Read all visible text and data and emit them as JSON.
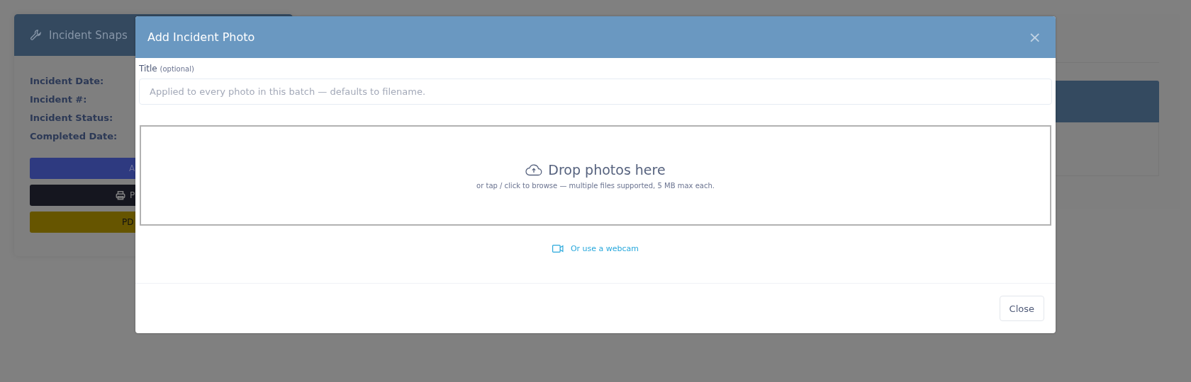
{
  "background_card": {
    "title": "Incident Snaps",
    "fields": [
      {
        "label": "Incident Date:"
      },
      {
        "label": "Incident #:"
      },
      {
        "label": "Incident Status:"
      },
      {
        "label": "Completed Date:"
      }
    ],
    "buttons": [
      {
        "kind": "primary",
        "label": "A"
      },
      {
        "kind": "dark",
        "label": "P"
      },
      {
        "kind": "warning",
        "label": "PD"
      }
    ]
  },
  "modal": {
    "title": "Add Incident Photo",
    "close_icon": "×",
    "title_field": {
      "label": "Title",
      "hint": "(optional)",
      "placeholder": "Applied to every photo in this batch — defaults to filename."
    },
    "dropzone": {
      "heading": "Drop photos here",
      "note": "or tap / click to browse — multiple files supported, 5 MB max each."
    },
    "webcam_link": "Or use a webcam",
    "footer_buttons": [
      "Close"
    ]
  }
}
